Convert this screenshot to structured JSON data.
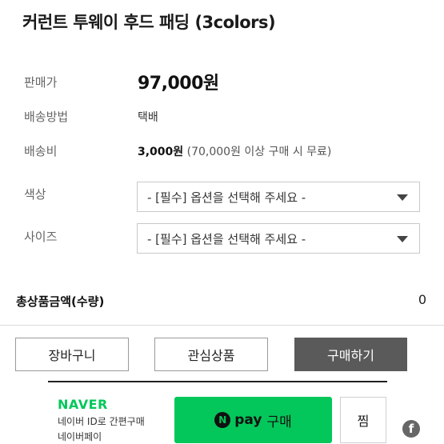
{
  "product": {
    "title": "커런트 투웨이 후드 패딩 (3colors)"
  },
  "info": {
    "price_label": "판매가",
    "price_value": "97,000원",
    "ship_method_label": "배송방법",
    "ship_method_value": "택배",
    "ship_fee_label": "배송비",
    "ship_fee_value": "3,000원",
    "ship_fee_note": "(70,000원 이상 구매 시 무료)"
  },
  "options": {
    "color_label": "색상",
    "color_value": "- [필수] 옵션을 선택해 주세요 -",
    "size_label": "사이즈",
    "size_value": "- [필수] 옵션을 선택해 주세요 -"
  },
  "total": {
    "label": "총상품금액(수량)",
    "value": "0"
  },
  "actions": {
    "cart_label": "장바구니",
    "wishlist_label": "관심상품",
    "buy_label": "구매하기"
  },
  "naver_pay": {
    "logo_text": "NAVER",
    "sub_line1": "네이버 ID로 간편구매",
    "sub_line2": "네이버페이",
    "badge": "N",
    "pay_text": "pay",
    "buy_text": "구매",
    "wish_label": "찜",
    "brand_color": "#03c75a"
  },
  "social": {
    "facebook_glyph": "f"
  }
}
